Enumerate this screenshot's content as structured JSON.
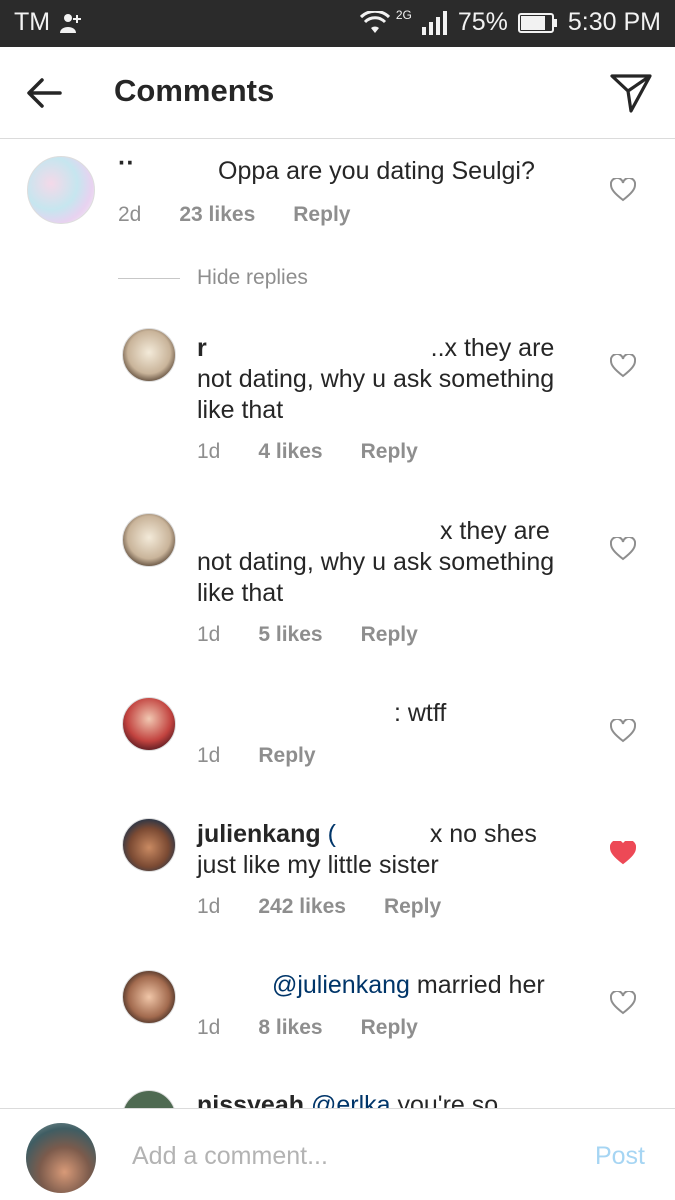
{
  "status_bar": {
    "carrier": "TM",
    "network": "2G",
    "battery": "75%",
    "time": "5:30 PM"
  },
  "header": {
    "title": "Comments",
    "back_icon": "arrow-left-icon",
    "share_icon": "send-icon"
  },
  "comments": [
    {
      "text_main": "Oppa are you dating Seulgi?",
      "age": "2d",
      "likes": "23 likes",
      "reply": "Reply",
      "liked": false
    },
    {
      "hide_replies": "Hide replies"
    },
    {
      "username": "r",
      "text_l1": "..x they are",
      "text_l2": "not dating, why u ask something",
      "text_l3": "like that",
      "age": "1d",
      "likes": "4 likes",
      "reply": "Reply",
      "liked": false
    },
    {
      "text_l1": "x they are",
      "text_l2": "not dating, why u ask something",
      "text_l3": "like that",
      "age": "1d",
      "likes": "5 likes",
      "reply": "Reply",
      "liked": false
    },
    {
      "text_l1": ": wtff",
      "age": "1d",
      "reply": "Reply",
      "liked": false
    },
    {
      "username": "julienkang",
      "paren": "(",
      "text_l1": "x no shes",
      "text_l2": "just like my little sister",
      "age": "1d",
      "likes": "242 likes",
      "reply": "Reply",
      "liked": true,
      "heart_color": "#ed4956"
    },
    {
      "mention": "@julienkang",
      "text_l1": "married her",
      "age": "1d",
      "likes": "8 likes",
      "reply": "Reply",
      "liked": false
    },
    {
      "username": "nissyeah",
      "mention": "@erlka",
      "text_l1": "you're so"
    }
  ],
  "composer": {
    "placeholder": "Add a comment...",
    "post_label": "Post",
    "post_color": "#a6d5f3"
  },
  "colors": {
    "status_bar_bg": "#2b2b2b",
    "meta_text": "#8e8e8e",
    "divider": "#dbdbdb"
  }
}
